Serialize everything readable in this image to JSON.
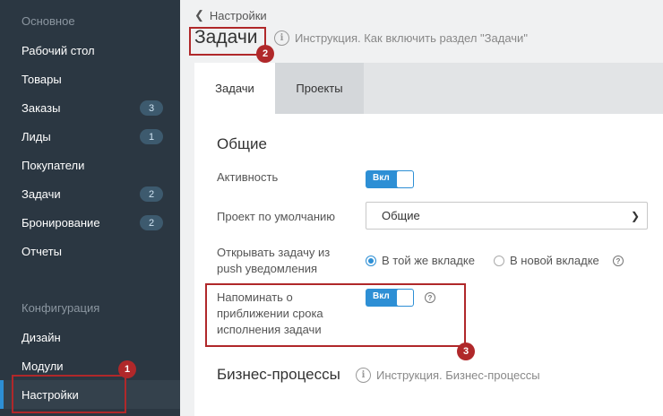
{
  "sidebar": {
    "section_main": "Основное",
    "section_config": "Конфигурация",
    "items": [
      {
        "label": "Рабочий стол",
        "badge": ""
      },
      {
        "label": "Товары",
        "badge": ""
      },
      {
        "label": "Заказы",
        "badge": "3"
      },
      {
        "label": "Лиды",
        "badge": "1"
      },
      {
        "label": "Покупатели",
        "badge": ""
      },
      {
        "label": "Задачи",
        "badge": "2"
      },
      {
        "label": "Бронирование",
        "badge": "2"
      },
      {
        "label": "Отчеты",
        "badge": ""
      }
    ],
    "config_items": [
      {
        "label": "Дизайн"
      },
      {
        "label": "Модули"
      },
      {
        "label": "Настройки"
      }
    ]
  },
  "header": {
    "back_label": "Настройки",
    "title": "Задачи",
    "help_link": "Инструкция. Как включить раздел \"Задачи\""
  },
  "tabs": [
    "Задачи",
    "Проекты"
  ],
  "general": {
    "heading": "Общие",
    "activity_label": "Активность",
    "activity_toggle": "Вкл",
    "default_project_label": "Проект по умолчанию",
    "default_project_value": "Общие",
    "open_task_label_1": "Открывать задачу из",
    "open_task_label_2": "push уведомления",
    "radio_same": "В той же вкладке",
    "radio_new": "В новой вкладке",
    "reminder_label_1": "Напоминать о",
    "reminder_label_2": "приближении срока",
    "reminder_label_3": "исполнения задачи",
    "reminder_toggle": "Вкл"
  },
  "business": {
    "heading": "Бизнес-процессы",
    "help_link": "Инструкция. Бизнес-процессы"
  },
  "markers": [
    "1",
    "2",
    "3"
  ],
  "colors": {
    "sidebar_bg": "#2b3742",
    "accent": "#2d8fd5",
    "annotation": "#b0282a"
  }
}
